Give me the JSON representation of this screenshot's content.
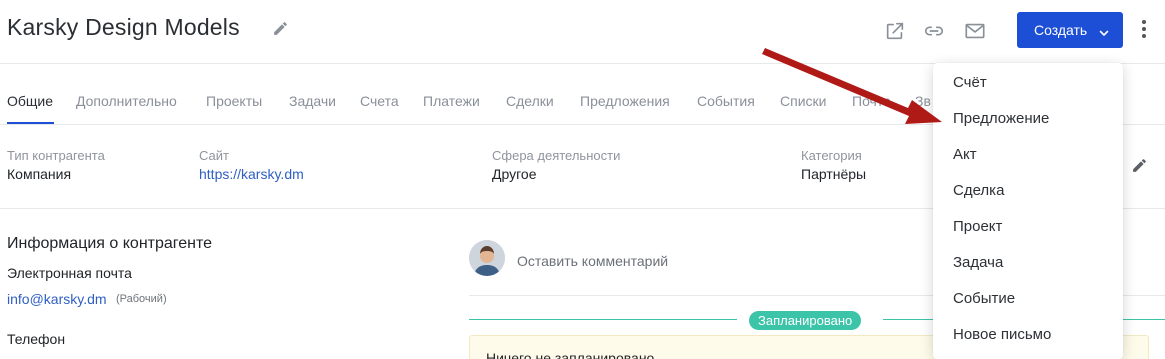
{
  "header": {
    "title": "Karsky Design Models",
    "create_label": "Создать",
    "icons": [
      "pencil-icon",
      "external-link-icon",
      "link-icon",
      "mail-icon",
      "chevron-down-icon",
      "more-vertical-icon"
    ],
    "accent_color": "#1c4fd6"
  },
  "tabs": [
    "Общие",
    "Дополнительно",
    "Проекты",
    "Задачи",
    "Счета",
    "Платежи",
    "Сделки",
    "Предложения",
    "События",
    "Списки",
    "Почта",
    "Зв"
  ],
  "active_tab": "Общие",
  "fields": [
    {
      "label": "Тип контрагента",
      "value": "Компания"
    },
    {
      "label": "Сайт",
      "value": "https://karsky.dm"
    },
    {
      "label": "Сфера деятельности",
      "value": "Другое"
    },
    {
      "label": "Категория",
      "value": "Партнёры"
    }
  ],
  "info": {
    "section_title": "Информация о контрагенте",
    "email_label": "Электронная почта",
    "email": "info@karsky.dm",
    "email_type": "(Рабочий)",
    "phone_label": "Телефон"
  },
  "activity": {
    "comment_placeholder": "Оставить комментарий",
    "planned_badge": "Запланировано",
    "nothing_planned": "Ничего не запланировано",
    "badge_color": "#3cc4a9"
  },
  "create_menu": [
    "Счёт",
    "Предложение",
    "Акт",
    "Сделка",
    "Проект",
    "Задача",
    "Событие",
    "Новое письмо"
  ],
  "annotation": {
    "arrow_color": "#b01a16"
  }
}
